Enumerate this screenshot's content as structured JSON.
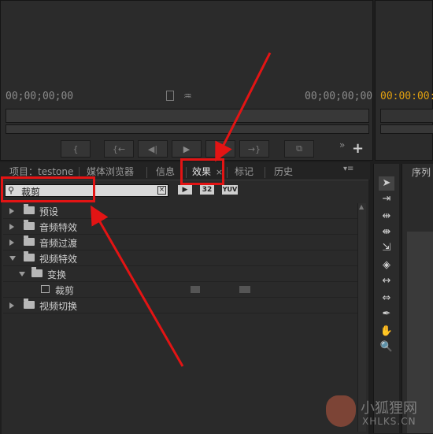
{
  "source_monitor": {
    "timecode_left": "00;00;00;00",
    "timecode_right": "00;00;00;00"
  },
  "program_monitor": {
    "timecode": "00:00:00:00"
  },
  "tabs": [
    {
      "label": "项目：testone",
      "active": false
    },
    {
      "label": "媒体浏览器",
      "active": false
    },
    {
      "label": "信息",
      "active": false
    },
    {
      "label": "效果",
      "active": true,
      "close": "×"
    },
    {
      "label": "标记",
      "active": false
    },
    {
      "label": "历史",
      "active": false
    }
  ],
  "right_tab": {
    "label": "序列"
  },
  "effects": {
    "search_value": "裁剪",
    "buttons": {
      "accelerated": "32",
      "yuv": "YUV"
    },
    "tree": [
      {
        "label": "预设",
        "expanded": false,
        "level": 0
      },
      {
        "label": "音频特效",
        "expanded": false,
        "level": 0
      },
      {
        "label": "音频过渡",
        "expanded": false,
        "level": 0
      },
      {
        "label": "视频特效",
        "expanded": true,
        "level": 0
      },
      {
        "label": "变换",
        "expanded": true,
        "level": 1
      },
      {
        "label": "裁剪",
        "level": 2,
        "item": true
      },
      {
        "label": "视频切换",
        "expanded": false,
        "level": 0
      }
    ]
  },
  "watermark": {
    "name": "小狐狸网",
    "url": "XHLKS.CN"
  },
  "colors": {
    "annotation_red": "#e31414",
    "timecode_gold": "#e0a010"
  }
}
